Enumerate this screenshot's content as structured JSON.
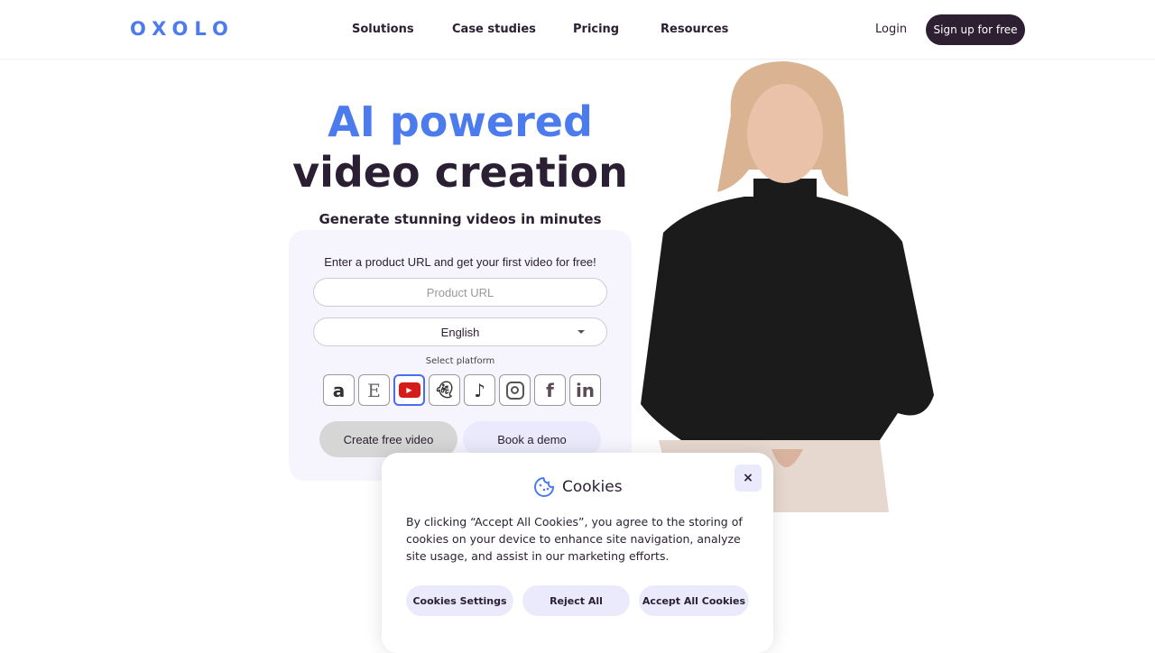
{
  "nav": {
    "logo": "OXOLO",
    "links": [
      "Solutions",
      "Case studies",
      "Pricing",
      "Resources"
    ],
    "login": "Login",
    "signup": "Sign up for free"
  },
  "hero": {
    "title_line1": "AI powered",
    "title_line2": "video creation",
    "subtitle": "Generate stunning videos in minutes"
  },
  "form": {
    "intro": "Enter a product URL and get your first video for free!",
    "url_placeholder": "Product URL",
    "language": "English",
    "select_platform": "Select platform",
    "platforms": [
      "amazon",
      "etsy",
      "youtube",
      "snapchat",
      "tiktok",
      "instagram",
      "facebook",
      "linkedin"
    ],
    "selected_platform": "youtube",
    "create_button": "Create free video",
    "demo_button": "Book a demo"
  },
  "cookies": {
    "title": "Cookies",
    "close": "×",
    "text": "By clicking “Accept All Cookies”, you agree to the storing of cookies on your device to enhance site navigation, analyze site usage, and assist in our marketing efforts.",
    "settings": "Cookies Settings",
    "reject": "Reject All",
    "accept": "Accept All Cookies"
  },
  "colors": {
    "brand": "#4b7bec",
    "dark": "#2e1f33",
    "soft": "#ebeafc"
  }
}
